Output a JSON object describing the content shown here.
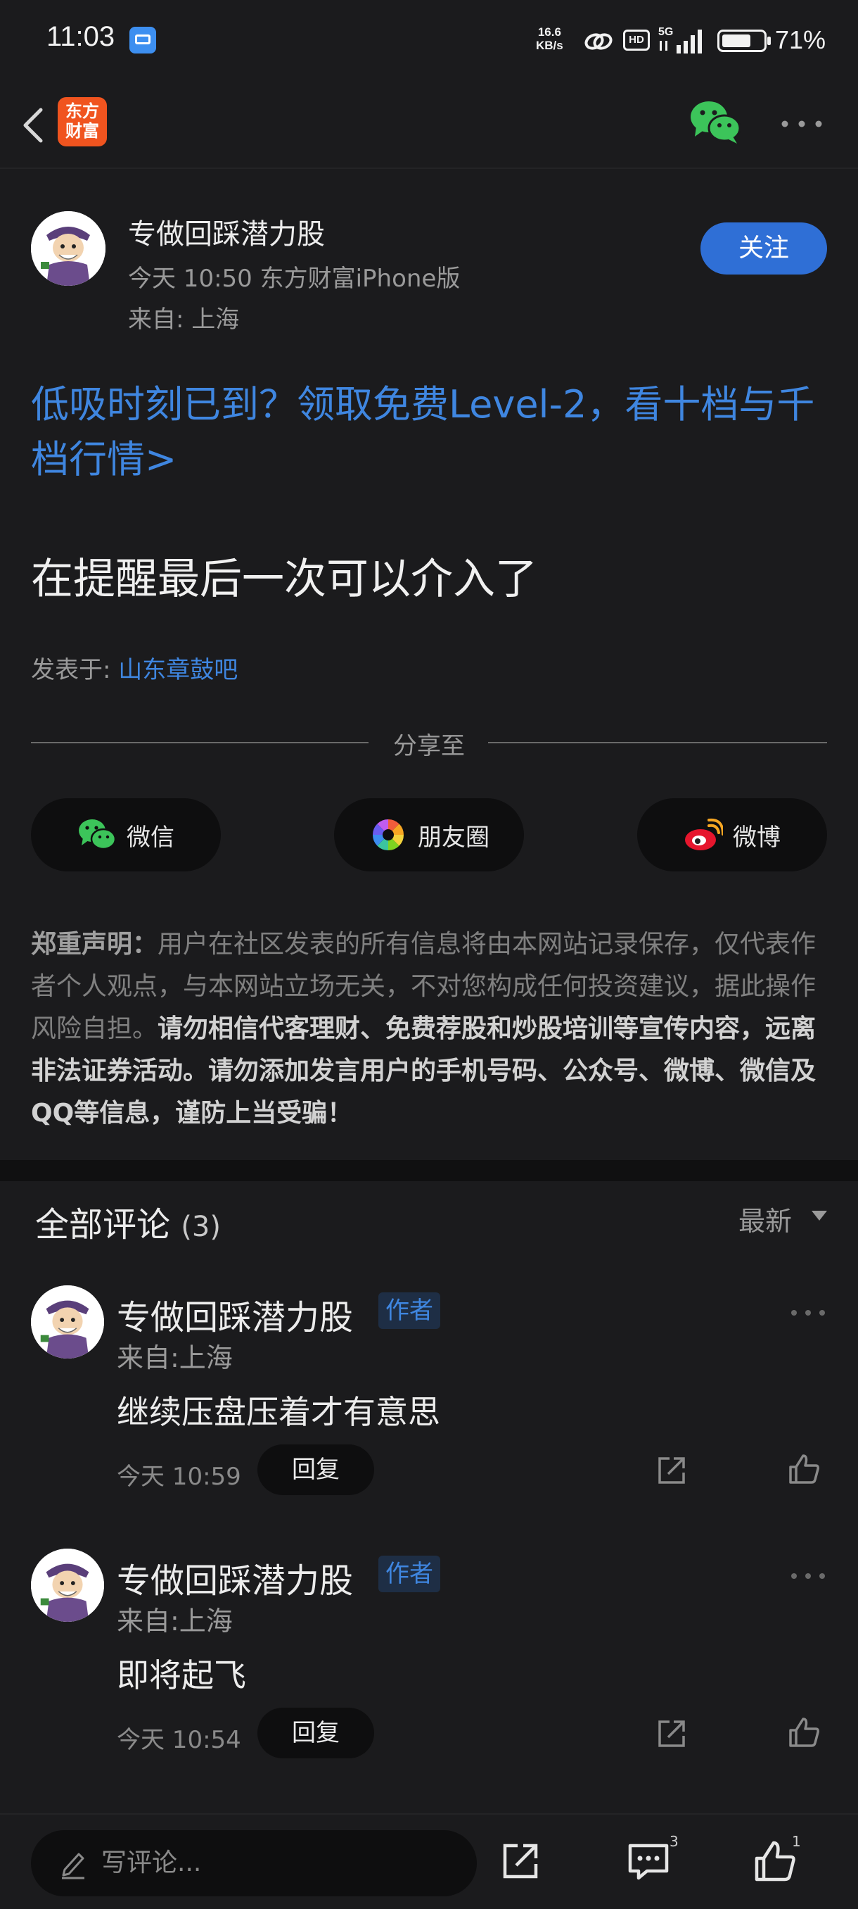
{
  "status_bar": {
    "time": "11:03",
    "net_speed_value": "16.6",
    "net_speed_unit": "KB/s",
    "hd": "HD",
    "network": "5G",
    "battery_level": 0.71,
    "battery_pct": "71%"
  },
  "nav": {
    "logo_text_line1": "东方",
    "logo_text_line2": "财富"
  },
  "post": {
    "author": "专做回踩潜力股",
    "meta": "今天 10:50 东方财富iPhone版",
    "location": "来自: 上海",
    "follow_label": "关注",
    "promo_link": "低吸时刻已到？领取免费Level-2，看十档与千档行情>",
    "title": "在提醒最后一次可以介入了",
    "board_prefix": "发表于: ",
    "board_name": "山东章鼓吧"
  },
  "share": {
    "label": "分享至",
    "wechat": "微信",
    "moments": "朋友圈",
    "weibo": "微博"
  },
  "disclaimer": {
    "heading": "郑重声明：",
    "body": "用户在社区发表的所有信息将由本网站记录保存，仅代表作者个人观点，与本网站立场无关，不对您构成任何投资建议，据此操作风险自担。",
    "warning": "请勿相信代客理财、免费荐股和炒股培训等宣传内容，远离非法证券活动。请勿添加发言用户的手机号码、公众号、微博、微信及QQ等信息，谨防上当受骗！"
  },
  "comments": {
    "title": "全部评论",
    "count": "(3)",
    "sort": "最新",
    "items": [
      {
        "author": "专做回踩潜力股",
        "badge": "作者",
        "location": "来自:上海",
        "text": "继续压盘压着才有意思",
        "time": "今天 10:59",
        "reply": "回复"
      },
      {
        "author": "专做回踩潜力股",
        "badge": "作者",
        "location": "来自:上海",
        "text": "即将起飞",
        "time": "今天 10:54",
        "reply": "回复"
      }
    ]
  },
  "bottom_bar": {
    "input_placeholder": "写评论...",
    "comment_count": "3",
    "like_count": "1"
  },
  "colors": {
    "background": "#1b1b1d",
    "accent_blue": "#3f86e0",
    "follow_button": "#2f6fd6",
    "logo_orange": "#f0541f",
    "wechat_green": "#3cc45a"
  }
}
